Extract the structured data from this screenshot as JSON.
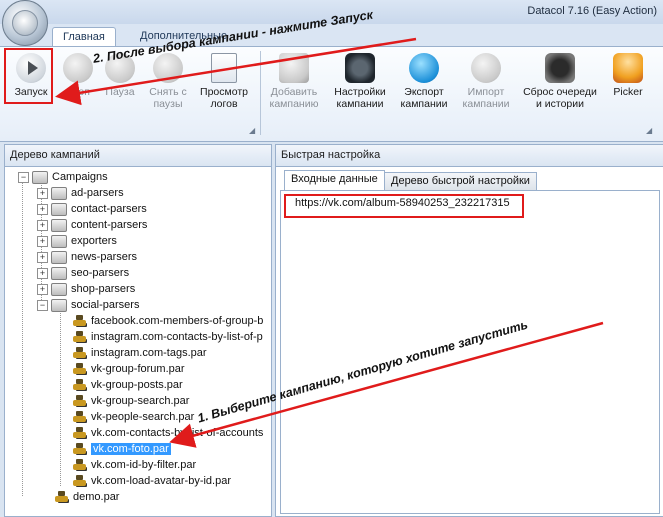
{
  "window": {
    "title": "Datacol 7.16 (Easy Action)"
  },
  "tabs": [
    "Главная",
    "Дополнительные"
  ],
  "ribbon": {
    "buttons": [
      {
        "label1": "Запуск",
        "label2": "",
        "icon": "play-icon",
        "enabled": true
      },
      {
        "label1": "Стоп",
        "label2": "",
        "icon": "stop-icon",
        "enabled": false
      },
      {
        "label1": "Пауза",
        "label2": "",
        "icon": "pause-icon",
        "enabled": false
      },
      {
        "label1": "Снять с",
        "label2": "паузы",
        "icon": "resume-icon",
        "enabled": false
      },
      {
        "label1": "Просмотр",
        "label2": "логов",
        "icon": "log-icon",
        "enabled": true
      },
      {
        "label1": "Добавить",
        "label2": "кампанию",
        "icon": "add-icon",
        "enabled": false
      },
      {
        "label1": "Настройки",
        "label2": "кампании",
        "icon": "gear-icon",
        "enabled": true
      },
      {
        "label1": "Экспорт",
        "label2": "кампании",
        "icon": "export-icon",
        "enabled": true
      },
      {
        "label1": "Импорт",
        "label2": "кампании",
        "icon": "import-icon",
        "enabled": false
      },
      {
        "label1": "Сброс очереди",
        "label2": "и истории",
        "icon": "reset-icon",
        "enabled": true
      },
      {
        "label1": "Picker",
        "label2": "",
        "icon": "picker-icon",
        "enabled": true
      }
    ]
  },
  "left_panel": {
    "title": "Дерево кампаний",
    "tree": {
      "root": "Campaigns",
      "folders": [
        "ad-parsers",
        "contact-parsers",
        "content-parsers",
        "exporters",
        "news-parsers",
        "seo-parsers",
        "shop-parsers",
        "social-parsers"
      ],
      "social_items": [
        "facebook.com-members-of-group-b",
        "instagram.com-contacts-by-list-of-p",
        "instagram.com-tags.par",
        "vk-group-forum.par",
        "vk-group-posts.par",
        "vk-group-search.par",
        "vk-people-search.par",
        "vk.com-contacts-by-list-of-accounts",
        "vk.com-foto.par",
        "vk.com-id-by-filter.par",
        "vk.com-load-avatar-by-id.par"
      ],
      "selected": "vk.com-foto.par",
      "root_files": [
        "demo.par"
      ]
    }
  },
  "right_panel": {
    "title": "Быстрая настройка",
    "tabs": [
      "Входные данные",
      "Дерево быстрой настройки"
    ],
    "input_text": "https://vk.com/album-58940253_232217315"
  },
  "annotations": {
    "step1": "1. Выберите кампанию, которую хотите запустить",
    "step2": "2. После выбора кампании - нажмите Запуск",
    "color": "#e01b1b"
  }
}
